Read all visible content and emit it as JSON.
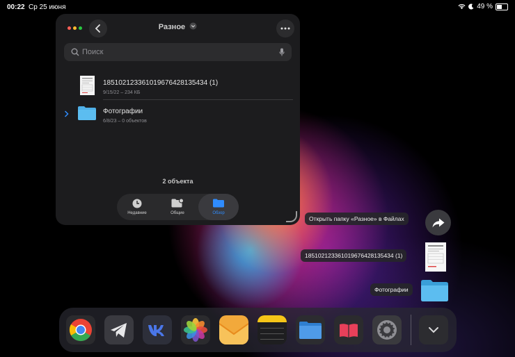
{
  "status_bar": {
    "time": "00:22",
    "date": "Ср 25 июня",
    "battery": "49 %"
  },
  "files_window": {
    "title": "Разное",
    "search_placeholder": "Поиск",
    "items": [
      {
        "name": "18510212336101967642813543​4 (1)",
        "meta": "9/15/22 – 234 КБ",
        "icon": "document-thumbnail-icon"
      },
      {
        "name": "Фотографии",
        "meta": "6/8/23 – 0 объектов",
        "icon": "folder-icon"
      }
    ],
    "count": "2 объекта",
    "tabs": [
      {
        "label": "Недавние",
        "icon": "clock-icon"
      },
      {
        "label": "Общие",
        "icon": "shared-folder-icon"
      },
      {
        "label": "Обзор",
        "icon": "folder-icon"
      }
    ]
  },
  "context": {
    "open_folder": "Открыть папку «Разное» в Файлах",
    "file_name": "18510212336101967642813543​4 (1)",
    "folder_name": "Фотографии"
  },
  "dock": {
    "apps": [
      "chrome-icon",
      "telegram-icon",
      "vk-icon",
      "photos-icon",
      "mail-icon",
      "notes-icon",
      "files-icon",
      "books-icon",
      "settings-icon"
    ]
  },
  "colors": {
    "accent": "#2f8cff",
    "window_bg": "#1c1c1e",
    "folder_blue": "#4fb0e8"
  }
}
